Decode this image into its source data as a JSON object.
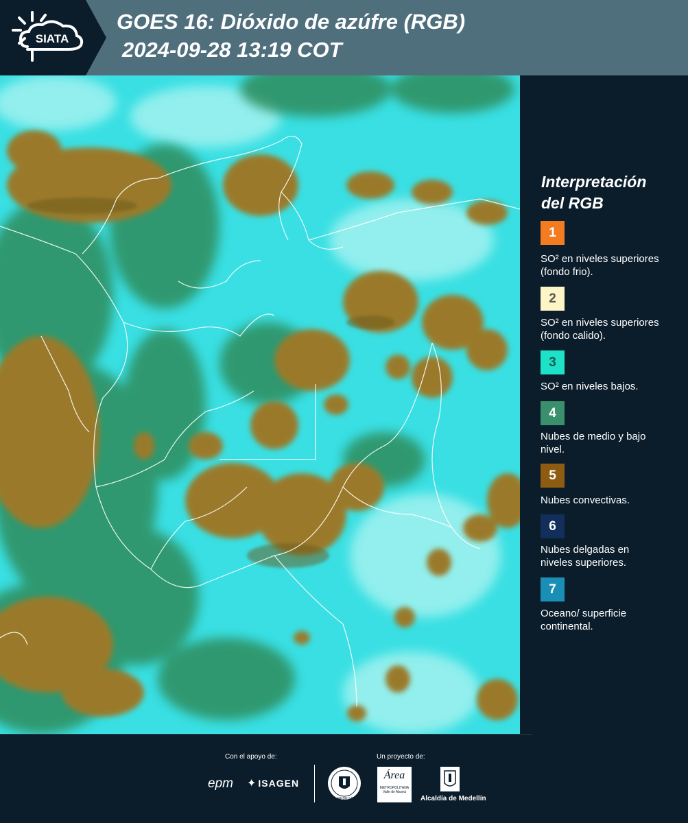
{
  "header": {
    "logo_text": "SIATA",
    "title_line1": "GOES 16: Dióxido de azúfre (RGB)",
    "title_line2": "2024-09-28 13:19 COT"
  },
  "legend": {
    "title_line1": "Interpretación",
    "title_line2": "del RGB",
    "items": [
      {
        "number": "1",
        "color": "#f47b20",
        "number_color": "#ffffff",
        "label": "SO² en niveles superiores (fondo frio)."
      },
      {
        "number": "2",
        "color": "#fdf5c6",
        "number_color": "#555555",
        "label": "SO² en niveles superiores (fondo calido)."
      },
      {
        "number": "3",
        "color": "#1de2c8",
        "number_color": "#1a5a52",
        "label": "SO² en niveles bajos."
      },
      {
        "number": "4",
        "color": "#3a8f6c",
        "number_color": "#ffffff",
        "label": "Nubes de medio y bajo nivel."
      },
      {
        "number": "5",
        "color": "#8d5c12",
        "number_color": "#ffffff",
        "label": "Nubes convectivas."
      },
      {
        "number": "6",
        "color": "#112f5a",
        "number_color": "#ffffff",
        "label": "Nubes delgadas en niveles superiores."
      },
      {
        "number": "7",
        "color": "#1a8fb5",
        "number_color": "#ffffff",
        "label": "Oceano/ superficie continental."
      }
    ]
  },
  "footer": {
    "support_caption": "Con el apoyo de:",
    "project_caption": "Un proyecto de:",
    "sponsor_epm": "epm",
    "sponsor_isagen": "ISAGEN",
    "partner_area_top": "Área",
    "partner_area_bottom": "METROPOLITANA",
    "partner_area_sub": "Valle de Aburrá",
    "partner_alcaldia": "Alcaldía de Medellín",
    "seal_text": "MEDELLÍN"
  },
  "colors": {
    "header_bg": "#4f6f7d",
    "page_bg": "#0b1d2b",
    "map_cyan": "#2fe0e6",
    "map_brown": "#9a7a2a",
    "map_green": "#2f8a5a"
  }
}
